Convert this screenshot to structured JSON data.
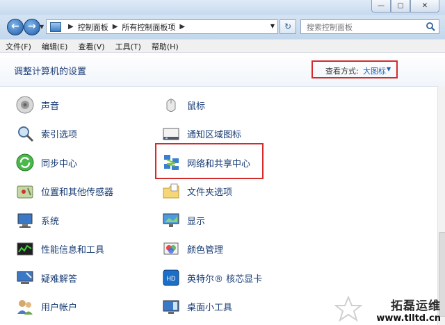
{
  "nav": {
    "back_glyph": "←",
    "forward_glyph": "→",
    "refresh_glyph": "↻"
  },
  "breadcrumb": [
    "控制面板",
    "所有控制面板项"
  ],
  "search": {
    "placeholder": "搜索控制面板"
  },
  "menu": [
    "文件(F)",
    "编辑(E)",
    "查看(V)",
    "工具(T)",
    "帮助(H)"
  ],
  "page_title": "调整计算机的设置",
  "view": {
    "label": "查看方式:",
    "value": "大图标"
  },
  "items": [
    {
      "label": "声音",
      "icon": "speaker-icon"
    },
    {
      "label": "鼠标",
      "icon": "mouse-icon"
    },
    {
      "label": "索引选项",
      "icon": "index-search-icon"
    },
    {
      "label": "通知区域图标",
      "icon": "notification-area-icon"
    },
    {
      "label": "同步中心",
      "icon": "sync-center-icon"
    },
    {
      "label": "网络和共享中心",
      "icon": "network-sharing-icon",
      "highlighted": true
    },
    {
      "label": "位置和其他传感器",
      "icon": "location-sensor-icon"
    },
    {
      "label": "文件夹选项",
      "icon": "folder-options-icon"
    },
    {
      "label": "系统",
      "icon": "system-icon"
    },
    {
      "label": "显示",
      "icon": "display-icon"
    },
    {
      "label": "性能信息和工具",
      "icon": "performance-icon"
    },
    {
      "label": "颜色管理",
      "icon": "color-management-icon"
    },
    {
      "label": "疑难解答",
      "icon": "troubleshooting-icon"
    },
    {
      "label": "英特尔® 核芯显卡",
      "icon": "intel-graphics-icon"
    },
    {
      "label": "用户帐户",
      "icon": "user-accounts-icon"
    },
    {
      "label": "桌面小工具",
      "icon": "desktop-gadgets-icon"
    }
  ],
  "watermark": {
    "site": "拓磊运维",
    "url": "www.tlltd.cn"
  },
  "colors": {
    "link": "#173c75",
    "highlight_box": "#d52a2a",
    "title": "#1e3d78"
  }
}
